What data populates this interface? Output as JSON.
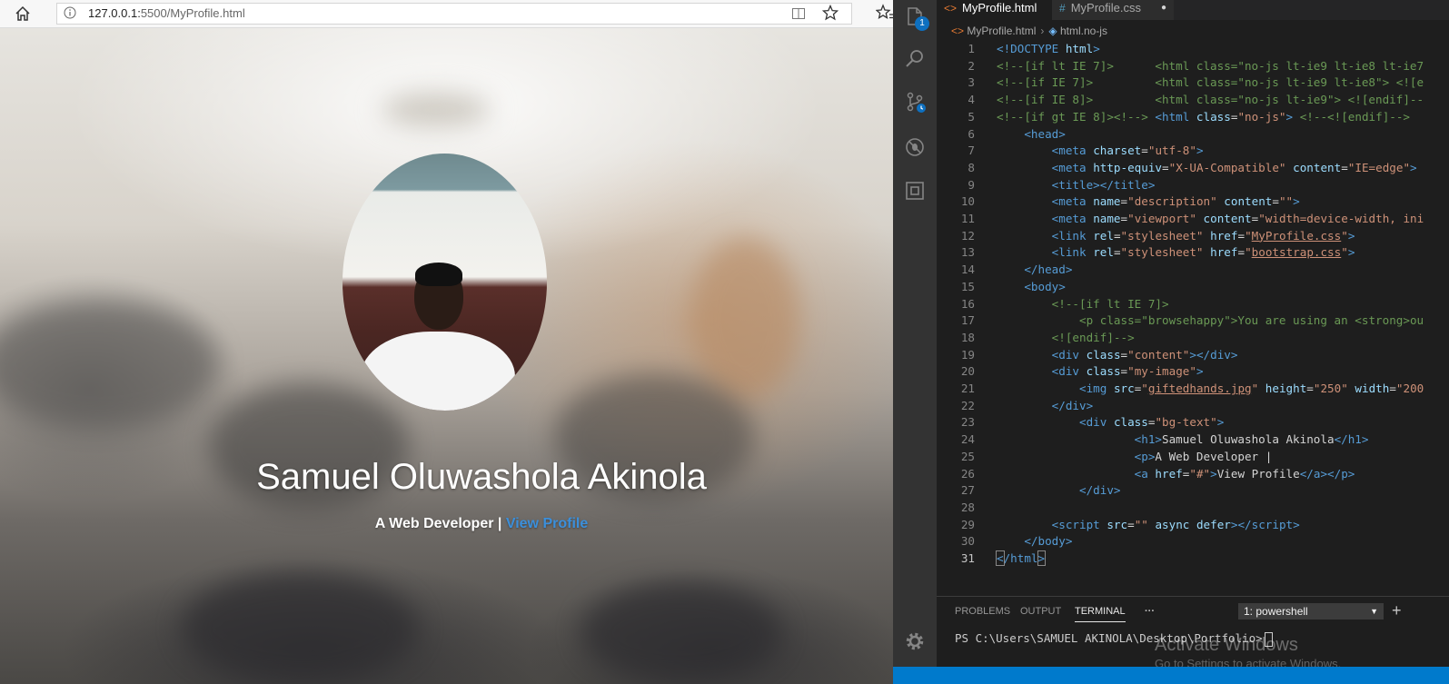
{
  "browser": {
    "url_host": "127.0.0.1:",
    "url_path": "5500/MyProfile.html"
  },
  "profile": {
    "name": "Samuel Oluwashola Akinola",
    "tagline": "A Web Developer |",
    "link": "View Profile"
  },
  "editor": {
    "tabs": [
      {
        "label": "MyProfile.html",
        "close": "×"
      },
      {
        "label": "MyProfile.css",
        "dot": "●"
      }
    ],
    "breadcrumb": [
      "MyProfile.html",
      "html.no-js"
    ],
    "activity_badge": "1",
    "lines": [
      "1",
      "2",
      "3",
      "4",
      "5",
      "6",
      "7",
      "8",
      "9",
      "10",
      "11",
      "12",
      "13",
      "14",
      "15",
      "16",
      "17",
      "18",
      "19",
      "20",
      "21",
      "22",
      "23",
      "24",
      "25",
      "26",
      "27",
      "28",
      "29",
      "30",
      "31"
    ]
  },
  "panel": {
    "tabs": [
      "PROBLEMS",
      "OUTPUT",
      "TERMINAL",
      "···"
    ],
    "terminal_select": "1: powershell",
    "plus": "+",
    "prompt": "PS C:\\Users\\SAMUEL AKINOLA\\Desktop\\Portfolio>",
    "watermark": "Activate Windows",
    "watermark_sub": "Go to Settings to activate Windows."
  }
}
